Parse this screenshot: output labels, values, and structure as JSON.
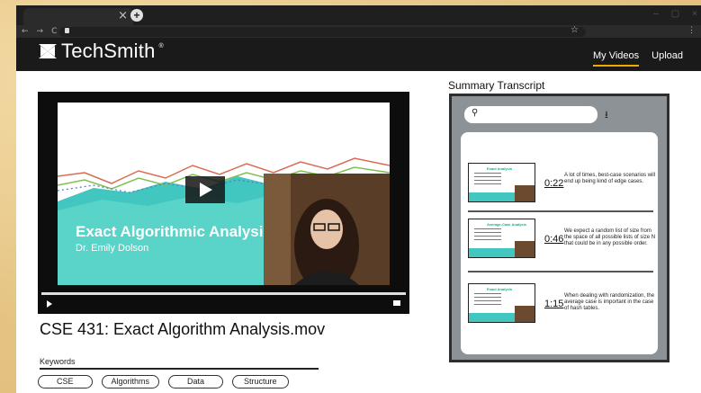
{
  "browser": {
    "tab_close": "×",
    "new_tab": "+",
    "window_controls": [
      "–",
      "▢",
      "×"
    ],
    "nav": [
      "←",
      "→",
      "C"
    ],
    "star": "☆",
    "menu": "⋮"
  },
  "header": {
    "brand": "TechSmith",
    "brand_reg": "®",
    "nav": [
      {
        "label": "My Videos",
        "active": true
      },
      {
        "label": "Upload",
        "active": false
      }
    ],
    "accent": "#f2a900"
  },
  "video": {
    "slide_title": "Exact Algorithmic Analysis",
    "slide_subtitle": "Dr. Emily Dolson",
    "title": "CSE 431: Exact Algorithm Analysis.mov"
  },
  "keywords": {
    "label": "Keywords",
    "items": [
      "CSE",
      "Algorithms",
      "Data",
      "Structure"
    ]
  },
  "transcript": {
    "heading": "Summary Transcript",
    "search_icon": "⚲",
    "download_icon": "⭳",
    "entries": [
      {
        "thumb_title": "Exact Analysis",
        "time": "0:22",
        "text": "A lot of times, best-case scenarios will end up being kind of edge cases."
      },
      {
        "thumb_title": "Average-Case Analysis",
        "time": "0:46",
        "text": "We expect a random list of size from the space of all possible lists of size N that could be in any possible order."
      },
      {
        "thumb_title": "Exact Analysis",
        "time": "1:15",
        "text": "When dealing with randomization, the average case is important in the case of hash tables."
      }
    ]
  },
  "colors": {
    "teal": "#41c6c0",
    "panel_gray": "#8d9297",
    "header_black": "#1a1a1a"
  }
}
